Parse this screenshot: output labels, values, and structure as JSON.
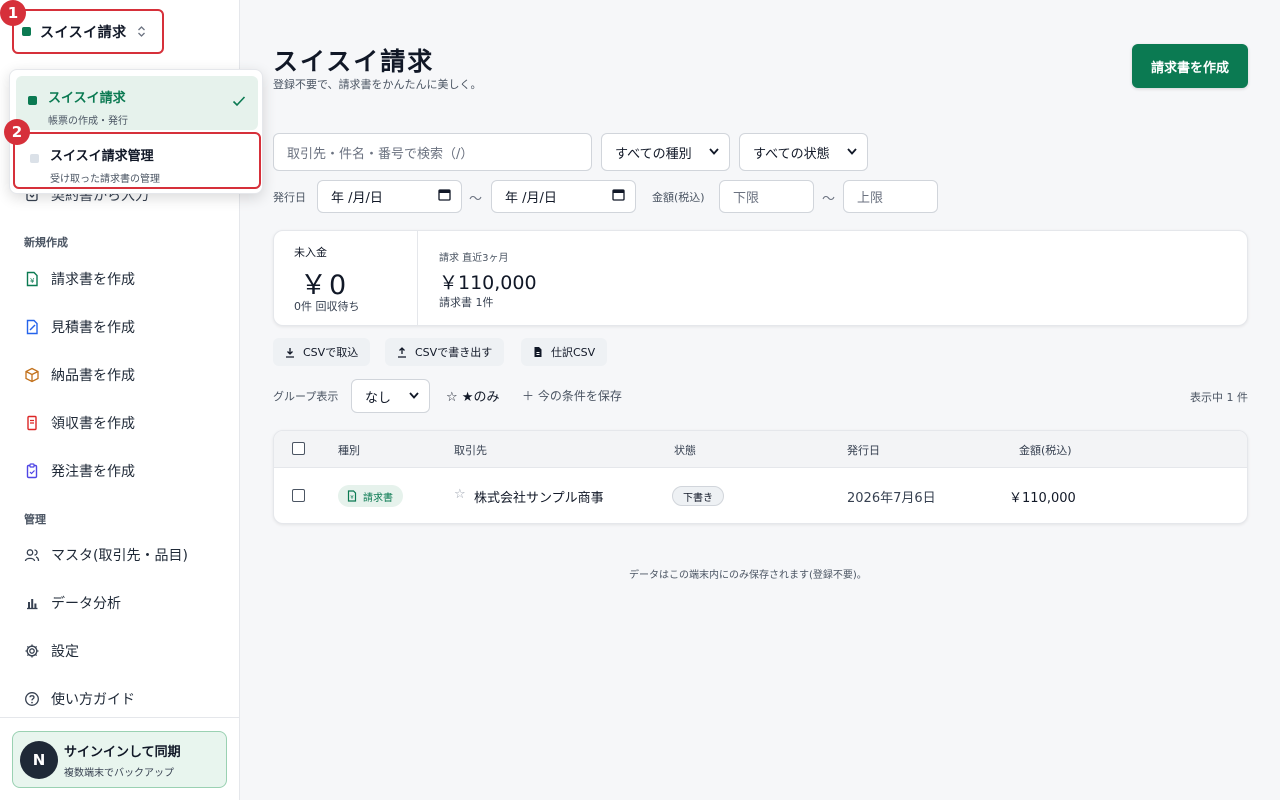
{
  "sidebar": {
    "app_name": "スイスイ請求",
    "partial_item": "契約書から入力",
    "section_new": "新規作成",
    "new_items": [
      {
        "label": "請求書を作成",
        "icon": "invoice-icon",
        "color": "#0b7a52"
      },
      {
        "label": "見積書を作成",
        "icon": "quote-icon",
        "color": "#2563eb"
      },
      {
        "label": "納品書を作成",
        "icon": "package-icon",
        "color": "#c2711b"
      },
      {
        "label": "領収書を作成",
        "icon": "receipt-icon",
        "color": "#dc2626"
      },
      {
        "label": "発注書を作成",
        "icon": "order-icon",
        "color": "#4f46e5"
      }
    ],
    "section_manage": "管理",
    "manage_items": [
      {
        "label": "マスタ(取引先・品目)",
        "icon": "users-icon"
      },
      {
        "label": "データ分析",
        "icon": "chart-icon"
      },
      {
        "label": "設定",
        "icon": "gear-icon"
      },
      {
        "label": "使い方ガイド",
        "icon": "help-icon"
      }
    ],
    "signin": {
      "avatar": "N",
      "title": "サインインして同期",
      "subtitle": "複数端末でバックアップ"
    }
  },
  "step_badges": [
    "1",
    "2"
  ],
  "dropdown": {
    "items": [
      {
        "title": "スイスイ請求",
        "subtitle": "帳票の作成・発行",
        "selected": true
      },
      {
        "title": "スイスイ請求管理",
        "subtitle": "受け取った請求書の管理",
        "selected": false
      }
    ]
  },
  "header": {
    "title": "スイスイ請求",
    "subtitle": "登録不要で、請求書をかんたんに美しく。",
    "create_button": "請求書を作成"
  },
  "filters": {
    "search_placeholder": "取引先・件名・番号で検索（/）",
    "type_select": "すべての種別",
    "status_select": "すべての状態",
    "date_label": "発行日",
    "date_from": "年 /月/日",
    "date_to": "年 /月/日",
    "tilde": "〜",
    "amount_label": "金額(税込)",
    "amount_min_placeholder": "下限",
    "amount_max_placeholder": "上限"
  },
  "summary": {
    "unpaid_label": "未入金",
    "unpaid_amount": "￥0",
    "unpaid_sub": "0件 回収待ち",
    "billing_label": "請求 直近3ヶ月",
    "billing_amount": "￥110,000",
    "billing_sub": "請求書 1件"
  },
  "actions": {
    "import_csv": "CSVで取込",
    "export_csv": "CSVで書き出す",
    "journal_csv": "仕訳CSV"
  },
  "grouping": {
    "label": "グループ表示",
    "value": "なし",
    "star_only": "☆ ★のみ",
    "save_conditions": "＋ 今の条件を保存",
    "count": "表示中 1 件"
  },
  "table": {
    "headers": [
      "種別",
      "取引先",
      "状態",
      "発行日",
      "金額(税込)"
    ],
    "rows": [
      {
        "type": "請求書",
        "client": "株式会社サンプル商事",
        "status": "下書き",
        "date": "2026年7月6日",
        "amount": "￥110,000"
      }
    ]
  },
  "footer_note": "データはこの端末内にのみ保存されます(登録不要)。",
  "colors": {
    "accent": "#0b7a52",
    "highlight": "#d6303a"
  }
}
